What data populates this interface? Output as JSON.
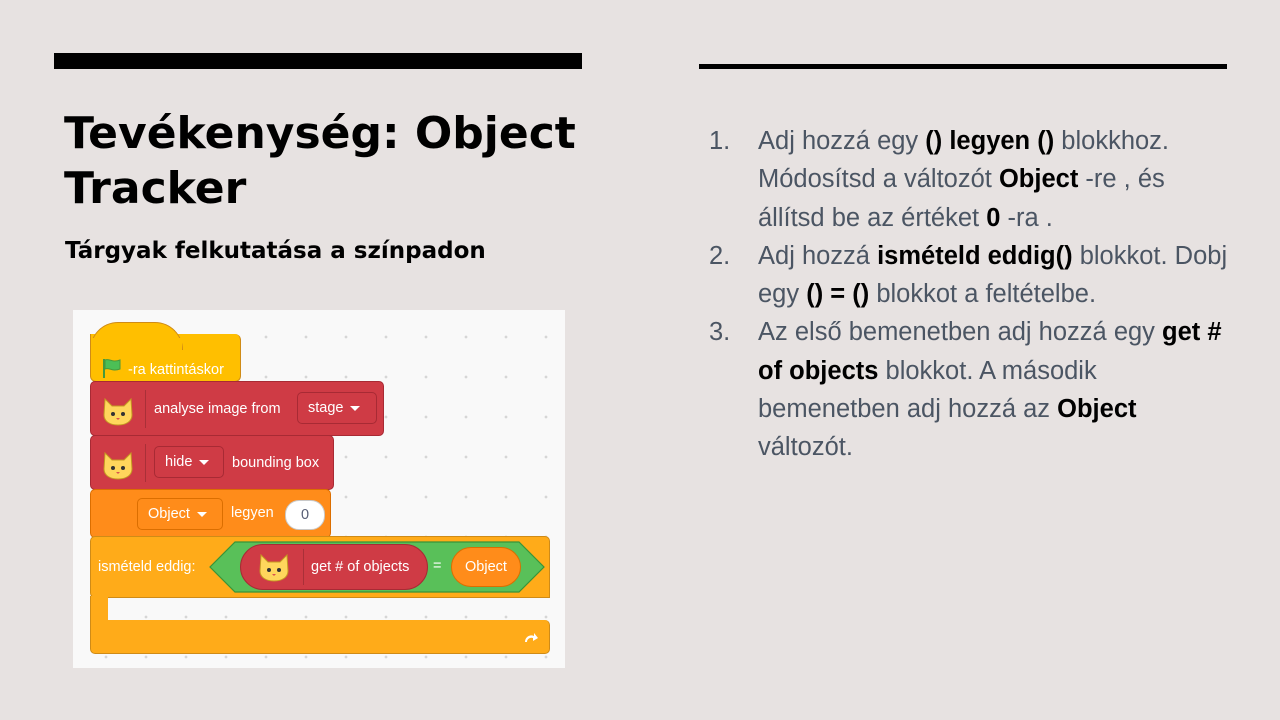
{
  "slide": {
    "title": "Tevékenység: Object Tracker",
    "subtitle": "Tárgyak felkutatása a színpadon"
  },
  "scratch": {
    "hat_label": "-ra kattintáskor",
    "analyse_label": "analyse image from",
    "analyse_dropdown": "stage",
    "hide_dropdown": "hide",
    "bounding_label": "bounding box",
    "variable_dropdown": "Object",
    "set_label": "legyen",
    "set_value": "0",
    "repeat_label": "ismételd eddig:",
    "get_objects_label": "get # of objects",
    "equals": "=",
    "object_reporter": "Object"
  },
  "steps": [
    {
      "num": "1.",
      "parts": [
        "Adj hozzá egy ",
        "() legyen ()",
        " blokkhoz. Módosítsd a változót ",
        "Object",
        " -re , és állítsd be az értéket ",
        "0",
        " -ra ."
      ]
    },
    {
      "num": "2.",
      "parts": [
        "Adj hozzá ",
        "ismételd eddig()",
        " blokkot. Dobj egy ",
        "() = ()",
        " blokkot a feltételbe."
      ]
    },
    {
      "num": "3.",
      "parts": [
        "Az első bemenetben adj hozzá egy ",
        "get # of objects",
        " blokkot. A második bemenetben adj hozzá az ",
        "Object",
        " változót."
      ]
    }
  ]
}
